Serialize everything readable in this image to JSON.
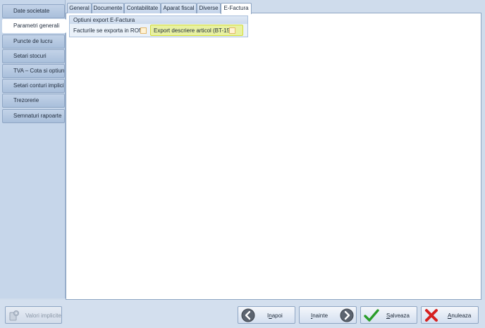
{
  "sidebar": {
    "items": [
      {
        "label": "Date societate",
        "active": false
      },
      {
        "label": "Parametri generali",
        "active": true
      },
      {
        "label": "Puncte de lucru",
        "active": false
      },
      {
        "label": "Setari stocuri",
        "active": false
      },
      {
        "label": "TVA – Cota si optiuni",
        "active": false
      },
      {
        "label": "Setari conturi implicite",
        "active": false
      },
      {
        "label": "Trezorerie",
        "active": false
      },
      {
        "label": "Semnaturi rapoarte",
        "active": false
      }
    ]
  },
  "tabs": [
    {
      "label": "General"
    },
    {
      "label": "Documente"
    },
    {
      "label": "Contabilitate"
    },
    {
      "label": "Aparat fiscal"
    },
    {
      "label": "Diverse"
    },
    {
      "label": "E-Factura",
      "active": true
    }
  ],
  "efactura": {
    "group_title": "Optiuni export E-Factura",
    "option1": {
      "label": "Facturile se exporta in RON",
      "checked": false
    },
    "option2": {
      "label": "Export descriere articol (BT-154)",
      "checked": false,
      "highlighted": true
    }
  },
  "buttons": {
    "defaults": {
      "label": "Valori implicite",
      "enabled": false
    },
    "back": {
      "label_pre": "I",
      "label_mark": "n",
      "label_post": "apoi"
    },
    "next": {
      "label_mark": "I",
      "label_post": "nainte"
    },
    "save": {
      "label_mark": "S",
      "label_post": "alveaza"
    },
    "cancel": {
      "label_mark": "A",
      "label_post": "nuleaza"
    }
  },
  "colors": {
    "highlight": "#e6f05a",
    "save_check": "#2a9d2a",
    "cancel_x": "#d62020"
  }
}
